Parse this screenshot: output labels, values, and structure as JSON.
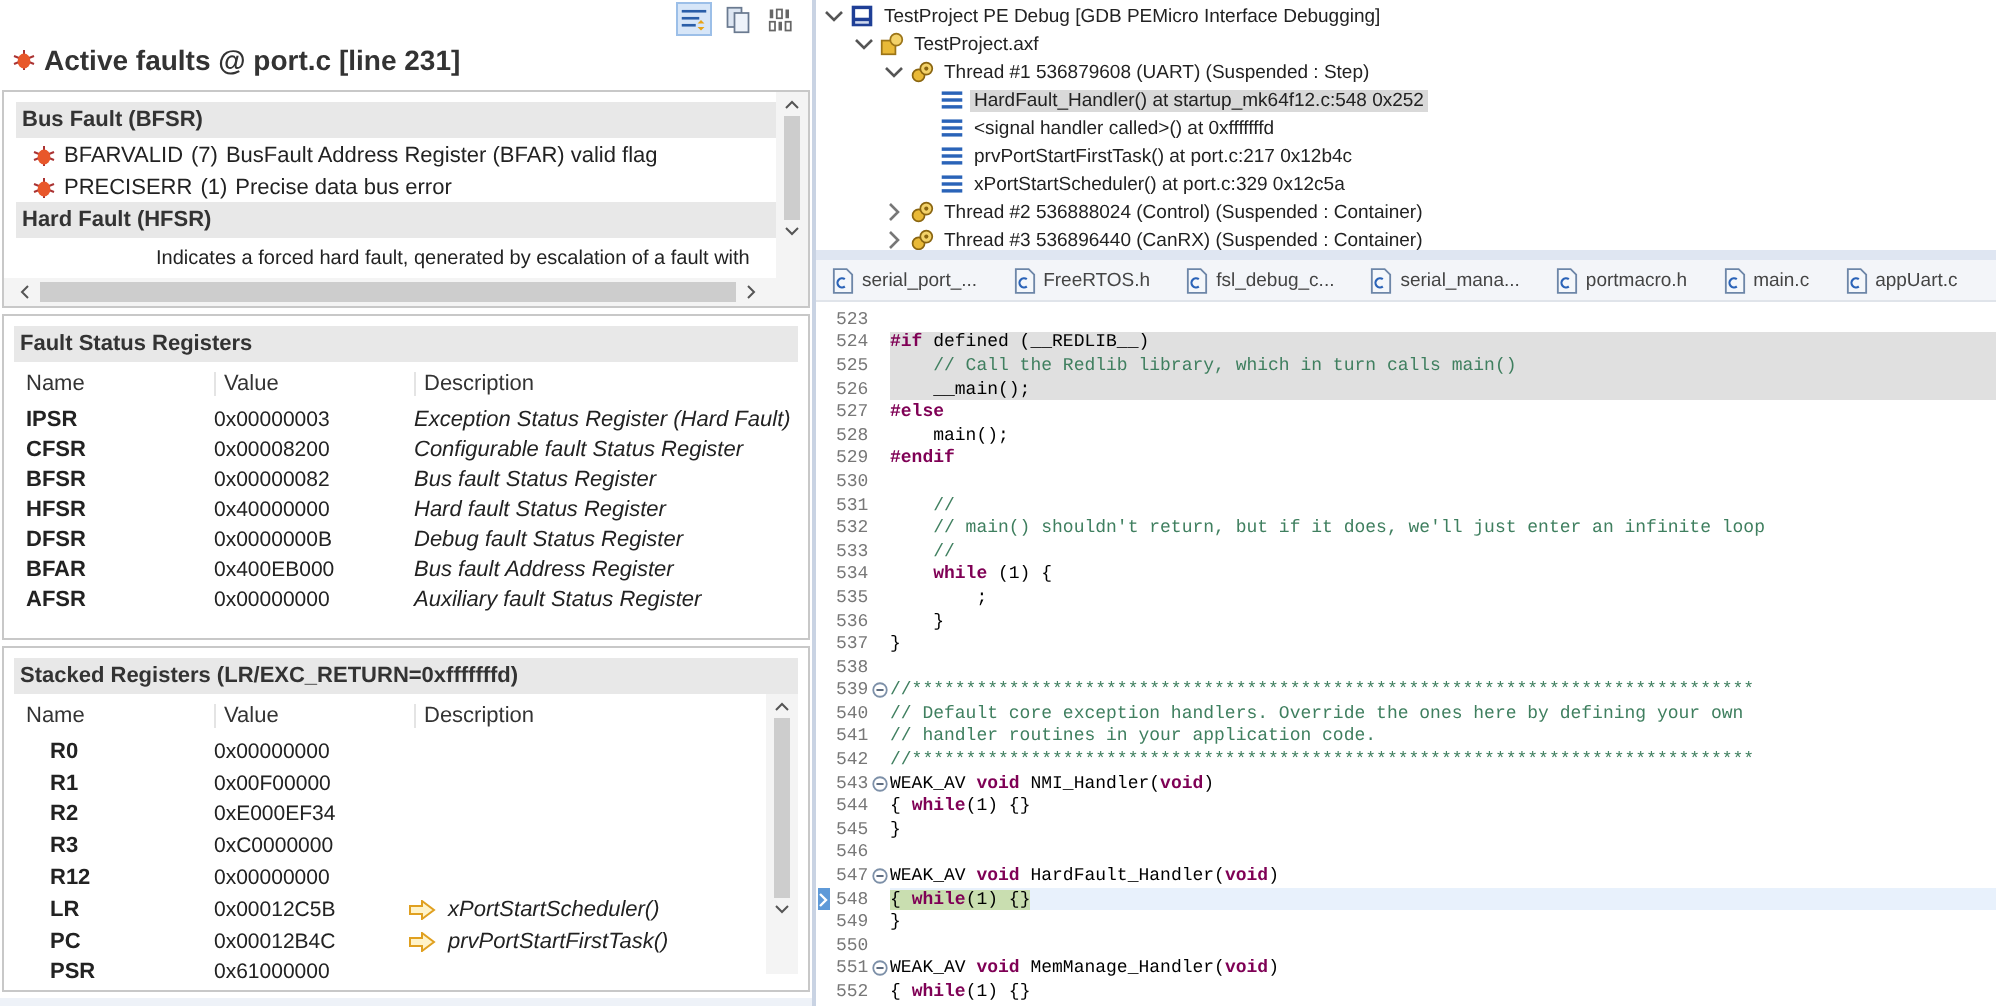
{
  "fault_view": {
    "toolbar": [
      {
        "kind": "details",
        "selected": true
      },
      {
        "kind": "copy",
        "selected": false
      },
      {
        "kind": "binary",
        "selected": false
      }
    ],
    "title": "Active faults @ port.c [line 231]",
    "active_faults": [
      {
        "heading": "Bus Fault (BFSR)",
        "items": [
          {
            "name": "BFARVALID",
            "bit": "(7)",
            "description": "BusFault Address Register (BFAR) valid flag"
          },
          {
            "name": "PRECISERR",
            "bit": "(1)",
            "description": "Precise data bus error"
          }
        ]
      },
      {
        "heading": "Hard Fault (HFSR)",
        "text": "Indicates a forced hard fault, qenerated by escalation of a fault with"
      }
    ],
    "fault_status_registers": {
      "heading": "Fault Status Registers",
      "columns": [
        "Name",
        "Value",
        "Description"
      ],
      "rows": [
        {
          "name": "IPSR",
          "value": "0x00000003",
          "description": "Exception Status Register (Hard Fault)"
        },
        {
          "name": "CFSR",
          "value": "0x00008200",
          "description": "Configurable fault Status Register"
        },
        {
          "name": "BFSR",
          "value": "0x00000082",
          "description": "Bus fault Status Register"
        },
        {
          "name": "HFSR",
          "value": "0x40000000",
          "description": "Hard fault Status Register"
        },
        {
          "name": "DFSR",
          "value": "0x0000000B",
          "description": "Debug fault Status Register"
        },
        {
          "name": "BFAR",
          "value": "0x400EB000",
          "description": "Bus fault Address Register"
        },
        {
          "name": "AFSR",
          "value": "0x00000000",
          "description": "Auxiliary fault Status Register"
        }
      ]
    },
    "stacked_registers": {
      "heading": "Stacked Registers (LR/EXC_RETURN=0xfffffffd)",
      "columns": [
        "Name",
        "Value",
        "Description"
      ],
      "rows": [
        {
          "name": "R0",
          "value": "0x00000000"
        },
        {
          "name": "R1",
          "value": "0x00F00000"
        },
        {
          "name": "R2",
          "value": "0xE000EF34"
        },
        {
          "name": "R3",
          "value": "0xC0000000"
        },
        {
          "name": "R12",
          "value": "0x00000000"
        },
        {
          "name": "LR",
          "value": "0x00012C5B",
          "description": "xPortStartScheduler()"
        },
        {
          "name": "PC",
          "value": "0x00012B4C",
          "description": "prvPortStartFirstTask()"
        },
        {
          "name": "PSR",
          "value": "0x61000000"
        }
      ]
    }
  },
  "debug_tree": [
    {
      "kind": "launch",
      "label": "TestProject PE Debug [GDB PEMicro Interface Debugging]",
      "expanded": true,
      "selected": false,
      "children": [
        {
          "kind": "process",
          "label": "TestProject.axf",
          "expanded": true,
          "selected": false,
          "children": [
            {
              "kind": "thread",
              "label": "Thread #1 536879608 (UART) (Suspended : Step)",
              "expanded": true,
              "selected": false,
              "children": [
                {
                  "kind": "frame",
                  "label": "HardFault_Handler() at startup_mk64f12.c:548 0x252",
                  "selected": true
                },
                {
                  "kind": "frame",
                  "label": "<signal handler called>() at 0xfffffffd",
                  "selected": false
                },
                {
                  "kind": "frame",
                  "label": "prvPortStartFirstTask() at port.c:217 0x12b4c",
                  "selected": false
                },
                {
                  "kind": "frame",
                  "label": "xPortStartScheduler() at port.c:329 0x12c5a",
                  "selected": false
                }
              ]
            },
            {
              "kind": "thread",
              "label": "Thread #2 536888024 (Control) (Suspended : Container)",
              "expanded": false,
              "selected": false
            },
            {
              "kind": "thread",
              "label": "Thread #3 536896440 (CanRX) (Suspended : Container)",
              "expanded": false,
              "selected": false
            }
          ]
        }
      ]
    }
  ],
  "editor_tabs": [
    {
      "label": "serial_port_...",
      "selected": false
    },
    {
      "label": "FreeRTOS.h",
      "selected": false
    },
    {
      "label": "fsl_debug_c...",
      "selected": false
    },
    {
      "label": "serial_mana...",
      "selected": false
    },
    {
      "label": "portmacro.h",
      "selected": false
    },
    {
      "label": "main.c",
      "selected": false
    },
    {
      "label": "appUart.c",
      "selected": false
    }
  ],
  "code": [
    {
      "number": "523"
    },
    {
      "number": "524",
      "highlighted": true,
      "segments": [
        {
          "kind": "pre",
          "text": "#if"
        },
        {
          "kind": "plain",
          "text": " defined (__REDLIB__)"
        }
      ]
    },
    {
      "number": "525",
      "highlighted": true,
      "segments": [
        {
          "kind": "comment",
          "text": "    // Call the Redlib library, which in turn calls main()"
        }
      ]
    },
    {
      "number": "526",
      "highlighted": true,
      "segments": [
        {
          "kind": "plain",
          "text": "    __main();"
        }
      ]
    },
    {
      "number": "527",
      "segments": [
        {
          "kind": "pre",
          "text": "#else"
        }
      ]
    },
    {
      "number": "528",
      "segments": [
        {
          "kind": "plain",
          "text": "    main();"
        }
      ]
    },
    {
      "number": "529",
      "segments": [
        {
          "kind": "pre",
          "text": "#endif"
        }
      ]
    },
    {
      "number": "530"
    },
    {
      "number": "531",
      "segments": [
        {
          "kind": "comment",
          "text": "    //"
        }
      ]
    },
    {
      "number": "532",
      "segments": [
        {
          "kind": "comment",
          "text": "    // main() shouldn't return, but if it does, we'll just enter an infinite loop"
        }
      ]
    },
    {
      "number": "533",
      "segments": [
        {
          "kind": "comment",
          "text": "    //"
        }
      ]
    },
    {
      "number": "534",
      "segments": [
        {
          "kind": "keyword",
          "text": "    while"
        },
        {
          "kind": "plain",
          "text": " (1) {"
        }
      ]
    },
    {
      "number": "535",
      "segments": [
        {
          "kind": "plain",
          "text": "        ;"
        }
      ]
    },
    {
      "number": "536",
      "segments": [
        {
          "kind": "plain",
          "text": "    }"
        }
      ]
    },
    {
      "number": "537",
      "segments": [
        {
          "kind": "plain",
          "text": "}"
        }
      ]
    },
    {
      "number": "538"
    },
    {
      "number": "539",
      "foldable": true,
      "segments": [
        {
          "kind": "comment",
          "text": "//******************************************************************************"
        }
      ]
    },
    {
      "number": "540",
      "segments": [
        {
          "kind": "comment",
          "text": "// Default core exception handlers. Override the ones here by defining your own"
        }
      ]
    },
    {
      "number": "541",
      "segments": [
        {
          "kind": "comment",
          "text": "// handler routines in your application code."
        }
      ]
    },
    {
      "number": "542",
      "segments": [
        {
          "kind": "comment",
          "text": "//******************************************************************************"
        }
      ]
    },
    {
      "number": "543",
      "foldable": true,
      "segments": [
        {
          "kind": "plain",
          "text": "WEAK_AV "
        },
        {
          "kind": "keyword",
          "text": "void"
        },
        {
          "kind": "plain",
          "text": " NMI_Handler("
        },
        {
          "kind": "keyword",
          "text": "void"
        },
        {
          "kind": "plain",
          "text": ")"
        }
      ]
    },
    {
      "number": "544",
      "segments": [
        {
          "kind": "plain",
          "text": "{ "
        },
        {
          "kind": "keyword",
          "text": "while"
        },
        {
          "kind": "plain",
          "text": "(1) {}"
        }
      ]
    },
    {
      "number": "545",
      "segments": [
        {
          "kind": "plain",
          "text": "}"
        }
      ]
    },
    {
      "number": "546"
    },
    {
      "number": "547",
      "foldable": true,
      "segments": [
        {
          "kind": "plain",
          "text": "WEAK_AV "
        },
        {
          "kind": "keyword",
          "text": "void"
        },
        {
          "kind": "plain",
          "text": " HardFault_Handler("
        },
        {
          "kind": "keyword",
          "text": "void"
        },
        {
          "kind": "plain",
          "text": ")"
        }
      ]
    },
    {
      "number": "548",
      "current": true,
      "segments": [
        {
          "kind": "plain",
          "text": "{ "
        },
        {
          "kind": "keyword",
          "text": "while"
        },
        {
          "kind": "plain",
          "text": "(1) {}"
        }
      ]
    },
    {
      "number": "549",
      "segments": [
        {
          "kind": "plain",
          "text": "}"
        }
      ]
    },
    {
      "number": "550"
    },
    {
      "number": "551",
      "foldable": true,
      "segments": [
        {
          "kind": "plain",
          "text": "WEAK_AV "
        },
        {
          "kind": "keyword",
          "text": "void"
        },
        {
          "kind": "plain",
          "text": " MemManage_Handler("
        },
        {
          "kind": "keyword",
          "text": "void"
        },
        {
          "kind": "plain",
          "text": ")"
        }
      ]
    },
    {
      "number": "552",
      "segments": [
        {
          "kind": "plain",
          "text": "{ "
        },
        {
          "kind": "keyword",
          "text": "while"
        },
        {
          "kind": "plain",
          "text": "(1) {}"
        }
      ]
    }
  ]
}
